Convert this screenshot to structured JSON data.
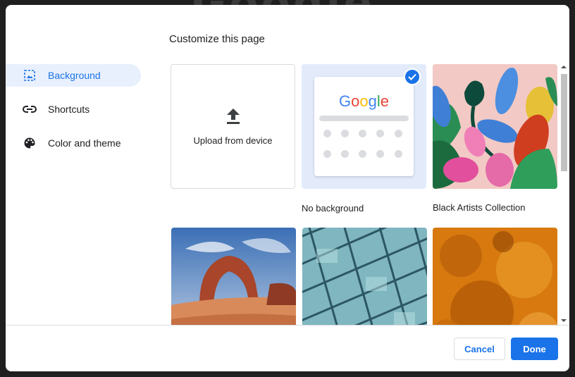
{
  "backdrop": {
    "logo_text": "Google"
  },
  "dialog": {
    "title": "Customize this page",
    "sidebar": {
      "items": [
        {
          "label": "Background",
          "icon": "image-icon",
          "active": true
        },
        {
          "label": "Shortcuts",
          "icon": "link-icon",
          "active": false
        },
        {
          "label": "Color and theme",
          "icon": "palette-icon",
          "active": false
        }
      ]
    },
    "tiles": {
      "upload_label": "Upload from device",
      "no_background_label": "No background",
      "no_background_preview_logo": "Google",
      "black_artists_label": "Black Artists Collection",
      "selected_tile": "No background"
    },
    "footer": {
      "cancel_label": "Cancel",
      "done_label": "Done"
    }
  },
  "colors": {
    "accent": "#1a73e8",
    "active_bg": "#e8f0fe",
    "selected_tile_bg": "#e3ebfb"
  }
}
